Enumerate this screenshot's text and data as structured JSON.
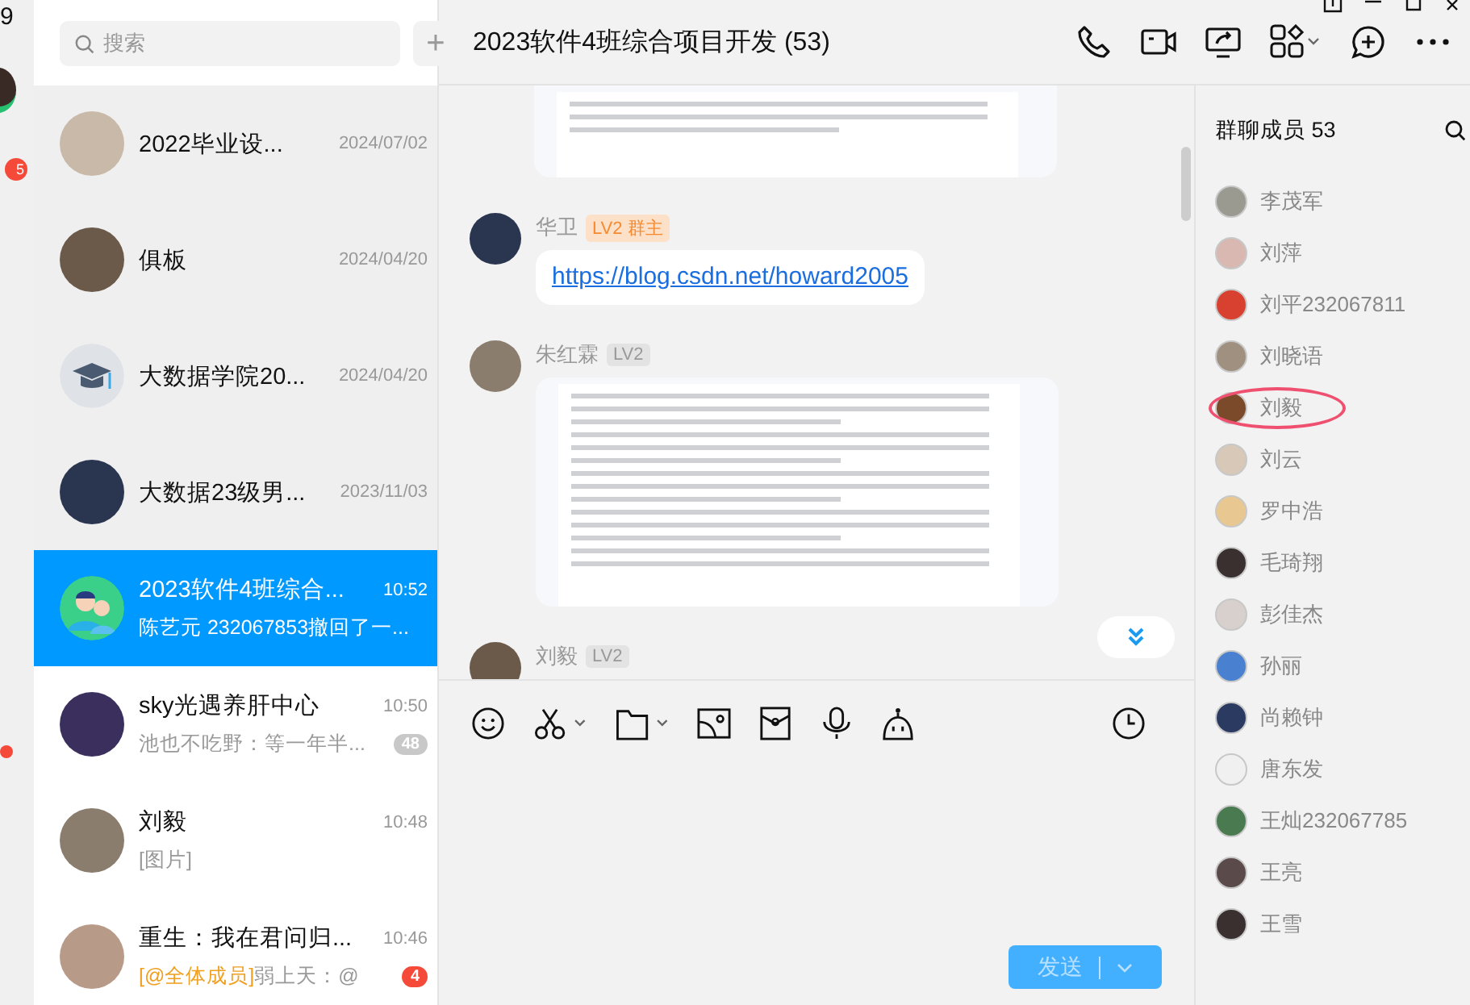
{
  "rail": {
    "top_text": "9",
    "badge": "5",
    "dot": true
  },
  "search": {
    "placeholder": "搜索"
  },
  "add_button": "+",
  "conversations": [
    {
      "name": "2022毕业设...",
      "time": "2024/07/02",
      "pinned": true,
      "selected": false,
      "avatar": {
        "kind": "photo"
      }
    },
    {
      "name": "俱板",
      "time": "2024/04/20",
      "pinned": true,
      "selected": false,
      "avatar": {
        "kind": "photo"
      }
    },
    {
      "name": "大数据学院20...",
      "time": "2024/04/20",
      "pinned": true,
      "selected": false,
      "avatar": {
        "kind": "cap"
      }
    },
    {
      "name": "大数据23级男...",
      "time": "2023/11/03",
      "pinned": true,
      "selected": false,
      "avatar": {
        "kind": "photo"
      }
    },
    {
      "name": "2023软件4班综合...",
      "time": "10:52",
      "preview": "陈艺元 232067853撤回了一...",
      "pinned": false,
      "selected": true,
      "avatar": {
        "kind": "group"
      }
    },
    {
      "name": "sky光遇养肝中心",
      "time": "10:50",
      "preview": "池也不吃野：等一年半...",
      "pinned": false,
      "selected": false,
      "avatar": {
        "kind": "photo"
      },
      "unread": {
        "count": "48",
        "kind": "muted"
      }
    },
    {
      "name": "刘毅",
      "time": "10:48",
      "preview": "[图片]",
      "pinned": false,
      "selected": false,
      "avatar": {
        "kind": "photo"
      }
    },
    {
      "name": "重生：我在君问归...",
      "time": "10:46",
      "mention": "[@全体成员]",
      "preview": "弱上天：@",
      "pinned": false,
      "selected": false,
      "avatar": {
        "kind": "photo"
      },
      "unread": {
        "count": "4",
        "kind": "alert"
      }
    }
  ],
  "chat": {
    "title": "2023软件4班综合项目开发 (53)",
    "messages": [
      {
        "kind": "image",
        "cut": true
      },
      {
        "kind": "link",
        "sender": "华卫",
        "badge": {
          "label": "LV2 群主",
          "kind": "owner"
        },
        "text": "https://blog.csdn.net/howard2005"
      },
      {
        "kind": "image",
        "sender": "朱红霖",
        "badge": {
          "label": "LV2",
          "kind": "level"
        }
      },
      {
        "kind": "header",
        "sender": "刘毅",
        "badge": {
          "label": "LV2",
          "kind": "level"
        }
      }
    ]
  },
  "send_button": {
    "label": "发送",
    "disabled": true
  },
  "members": {
    "title": "群聊成员",
    "count": "53",
    "list": [
      {
        "name": "李茂军",
        "circled": false
      },
      {
        "name": "刘萍",
        "circled": false
      },
      {
        "name": "刘平232067811",
        "circled": false
      },
      {
        "name": "刘晓语",
        "circled": false
      },
      {
        "name": "刘毅",
        "circled": true
      },
      {
        "name": "刘云",
        "circled": false
      },
      {
        "name": "罗中浩",
        "circled": false
      },
      {
        "name": "毛琦翔",
        "circled": false
      },
      {
        "name": "彭佳杰",
        "circled": false
      },
      {
        "name": "孙丽",
        "circled": false
      },
      {
        "name": "尚赖钟",
        "circled": false
      },
      {
        "name": "唐东发",
        "circled": false
      },
      {
        "name": "王灿232067785",
        "circled": false
      },
      {
        "name": "王亮",
        "circled": false
      },
      {
        "name": "王雪",
        "circled": false
      }
    ]
  }
}
